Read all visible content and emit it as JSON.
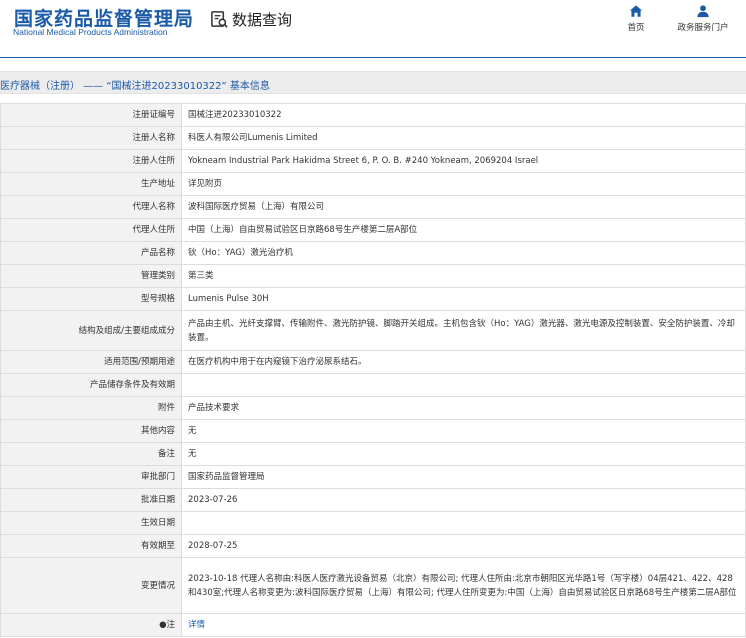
{
  "header": {
    "logo_cn": "国家药品监督管理局",
    "logo_en": "National Medical Products Administration",
    "search_title": "数据查询",
    "nav": [
      {
        "label": "首页",
        "icon": "home-icon"
      },
      {
        "label": "政务服务门户",
        "icon": "user-icon"
      }
    ],
    "brand_color": "#1b5aa7"
  },
  "breadcrumb": {
    "text": "医疗器械（注册） —— “国械注进20233010322” 基本信息"
  },
  "details": [
    {
      "label": "注册证编号",
      "value": "国械注进20233010322"
    },
    {
      "label": "注册人名称",
      "value": "科医人有限公司Lumenis Limited"
    },
    {
      "label": "注册人住所",
      "value": "Yokneam Industrial Park Hakidma Street 6, P. O. B. #240 Yokneam, 2069204 Israel"
    },
    {
      "label": "生产地址",
      "value": "详见附页"
    },
    {
      "label": "代理人名称",
      "value": "波科国际医疗贸易（上海）有限公司"
    },
    {
      "label": "代理人住所",
      "value": "中国（上海）自由贸易试验区日京路68号生产楼第二层A部位"
    },
    {
      "label": "产品名称",
      "value": "钬（Ho：YAG）激光治疗机"
    },
    {
      "label": "管理类别",
      "value": "第三类"
    },
    {
      "label": "型号规格",
      "value": "Lumenis Pulse 30H"
    },
    {
      "label": "结构及组成/主要组成成分",
      "value": "产品由主机、光纤支撑臂、传输附件、激光防护镜、脚踏开关组成。主机包含钬（Ho：YAG）激光器、激光电源及控制装置、安全防护装置、冷却装置。"
    },
    {
      "label": "适用范围/预期用途",
      "value": "在医疗机构中用于在内窥镜下治疗泌尿系结石。"
    },
    {
      "label": "产品储存条件及有效期",
      "value": ""
    },
    {
      "label": "附件",
      "value": "产品技术要求"
    },
    {
      "label": "其他内容",
      "value": "无"
    },
    {
      "label": "备注",
      "value": "无"
    },
    {
      "label": "审批部门",
      "value": "国家药品监督管理局"
    },
    {
      "label": "批准日期",
      "value": "2023-07-26"
    },
    {
      "label": "生效日期",
      "value": ""
    },
    {
      "label": "有效期至",
      "value": "2028-07-25"
    },
    {
      "label": "变更情况",
      "value": "2023-10-18 代理人名称由:科医人医疗激光设备贸易（北京）有限公司; 代理人住所由:北京市朝阳区光华路1号（写字楼）04层421、422、428和430室;代理人名称变更为:波科国际医疗贸易（上海）有限公司; 代理人住所变更为:中国（上海）自由贸易试验区日京路68号生产楼第二层A部位"
    },
    {
      "label": "●注",
      "value": "详情"
    }
  ]
}
